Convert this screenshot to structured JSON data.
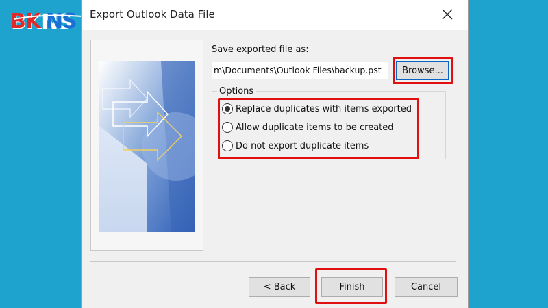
{
  "logo": {
    "text": "BKNS"
  },
  "dialog": {
    "title": "Export Outlook Data File",
    "save_label": "Save exported file as:",
    "path_value": "m\\Documents\\Outlook Files\\backup.pst",
    "browse_label": "Browse...",
    "options_legend": "Options",
    "options": [
      {
        "label": "Replace duplicates with items exported",
        "selected": true
      },
      {
        "label": "Allow duplicate items to be created",
        "selected": false
      },
      {
        "label": "Do not export duplicate items",
        "selected": false
      }
    ],
    "back_label": "< Back",
    "finish_label": "Finish",
    "cancel_label": "Cancel"
  },
  "colors": {
    "background": "#1ea3cf",
    "highlight": "#e01010",
    "logo_red": "#e02a2a",
    "logo_blue": "#1a6fd4"
  },
  "icons": [
    "close-icon",
    "wizard-graphic"
  ]
}
